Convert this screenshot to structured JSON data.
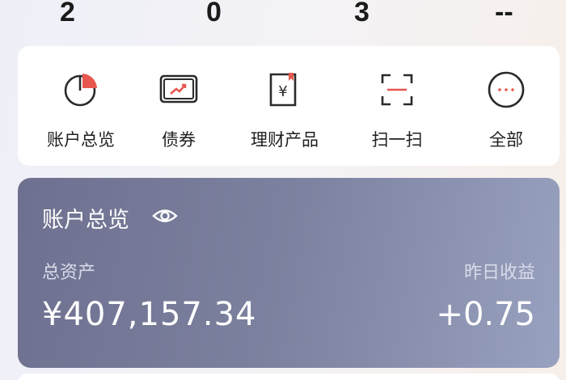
{
  "stats": [
    "2",
    "0",
    "3",
    "--"
  ],
  "shortcuts": [
    {
      "label": "账户总览",
      "icon": "pie-chart-icon"
    },
    {
      "label": "债券",
      "icon": "bond-ticket-icon"
    },
    {
      "label": "理财产品",
      "icon": "wealth-product-icon"
    },
    {
      "label": "扫一扫",
      "icon": "scan-icon"
    },
    {
      "label": "全部",
      "icon": "more-icon"
    }
  ],
  "account": {
    "title": "账户总览",
    "total_assets_label": "总资产",
    "total_assets_value": "¥407,157.34",
    "yesterday_income_label": "昨日收益",
    "yesterday_income_value": "+0.75"
  },
  "colors": {
    "card_gradient_start": "#6e708f",
    "card_gradient_end": "#98a1bf",
    "accent_red": "#d9453f"
  }
}
